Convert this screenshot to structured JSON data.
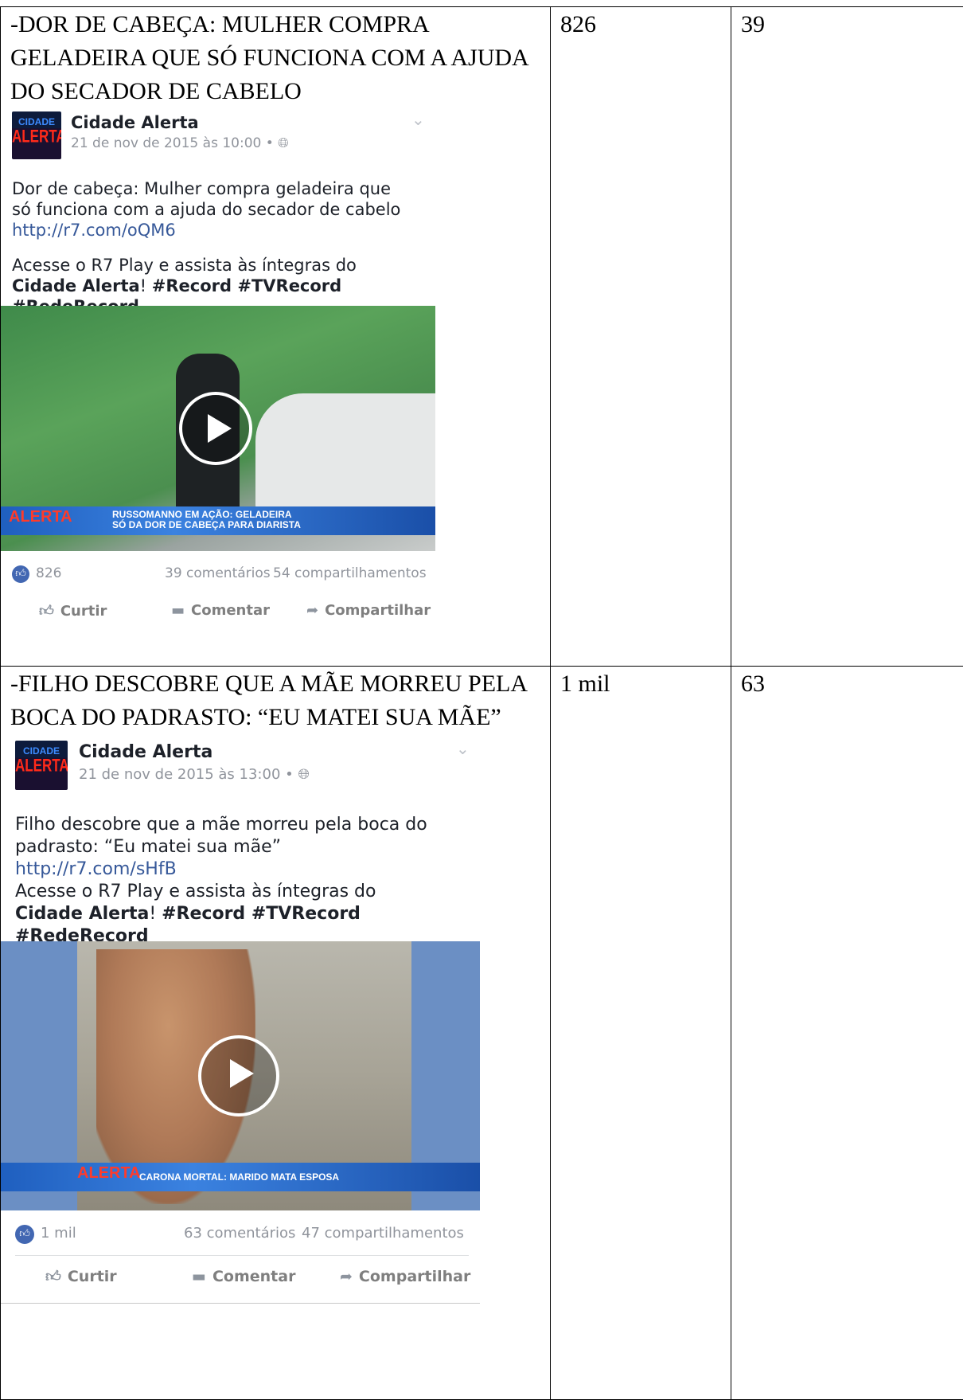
{
  "rows": [
    {
      "title": "-DOR DE CABEÇA: MULHER COMPRA GELADEIRA QUE SÓ FUNCIONA COM A AJUDA DO SECADOR DE CABELO",
      "likes": "826",
      "comments": "39",
      "post": {
        "logo_top": "CIDADE",
        "logo_bottom": "ALERTA",
        "page_name": "Cidade Alerta",
        "meta": "21 de nov de 2015 às 10:00 • ",
        "text_a": "Dor de cabeça: Mulher compra geladeira que só funciona com a ajuda do secador de cabelo ",
        "link": "http://r7.com/oQM6",
        "text_b1": "Acesse o R7 Play e assista às íntegras do ",
        "text_b_bold1": "Cidade Alerta",
        "text_b2": "! ",
        "text_b_tags": "#Record #TVRecord #RedeRecord",
        "banner_logo": "ALERTA",
        "banner_text": "RUSSOMANNO EM AÇÃO: GELADEIRA SÓ DA DOR DE CABEÇA PARA DIARISTA",
        "like_count": "826",
        "comments_text": "39 comentários",
        "shares_text": "54 compartilhamentos",
        "action_like": "Curtir",
        "action_comment": "Comentar",
        "action_share": "Compartilhar"
      }
    },
    {
      "title": "-FILHO DESCOBRE QUE A MÃE MORREU PELA BOCA DO PADRASTO: “EU MATEI SUA MÃE”",
      "likes": "1 mil",
      "comments": "63",
      "post": {
        "logo_top": "CIDADE",
        "logo_bottom": "ALERTA",
        "page_name": "Cidade Alerta",
        "meta": "21 de nov de 2015 às 13:00 • ",
        "text_a": "Filho descobre que a mãe morreu pela boca do padrasto: “Eu matei sua mãe” ",
        "link": "http://r7.com/sHfB",
        "text_b1": "Acesse o R7 Play e assista às íntegras do ",
        "text_b_bold1": "Cidade Alerta",
        "text_b2": "! ",
        "text_b_tags": "#Record #TVRecord #RedeRecord",
        "banner_logo": "ALERTA",
        "banner_text": "CARONA MORTAL: MARIDO MATA ESPOSA",
        "like_count": "1 mil",
        "comments_text": "63 comentários",
        "shares_text": "47 compartilhamentos",
        "action_like": "Curtir",
        "action_comment": "Comentar",
        "action_share": "Compartilhar"
      }
    }
  ],
  "icons": {
    "globe": "globe-icon",
    "chevron": "chevron-down-icon",
    "like": "thumbs-up-icon",
    "comment": "comment-icon",
    "share": "share-icon",
    "play": "play-icon"
  },
  "colors": {
    "link": "#365899",
    "facebook_blue": "#4267b2",
    "meta_gray": "#90949c"
  }
}
